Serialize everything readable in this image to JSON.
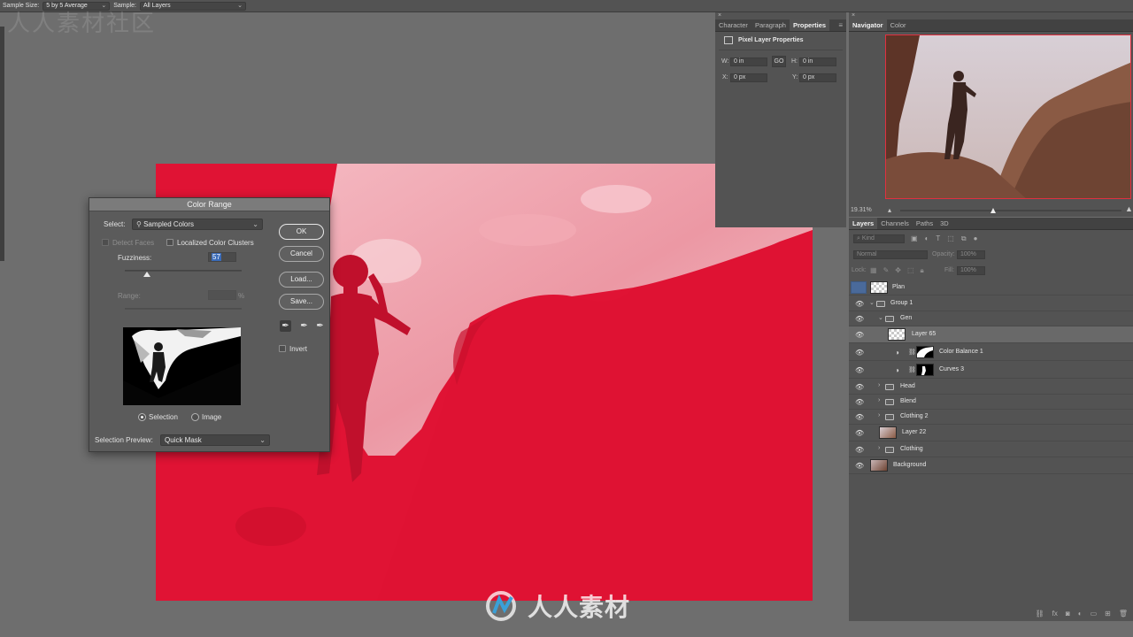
{
  "options_bar": {
    "sample_size_label": "Sample Size:",
    "sample_size_value": "5 by 5 Average",
    "sample_label": "Sample:",
    "sample_value": "All Layers"
  },
  "watermark": {
    "top_text": "人人素材社区",
    "bottom_text": "人人素材"
  },
  "color_range": {
    "title": "Color Range",
    "select_label": "Select:",
    "select_value": "Sampled Colors",
    "detect_faces_label": "Detect Faces",
    "localized_label": "Localized Color Clusters",
    "fuzziness_label": "Fuzziness:",
    "fuzziness_value": "57",
    "range_label": "Range:",
    "range_unit": "%",
    "buttons": {
      "ok": "OK",
      "cancel": "Cancel",
      "load": "Load...",
      "save": "Save..."
    },
    "invert_label": "Invert",
    "radio_selection": "Selection",
    "radio_image": "Image",
    "preview_label": "Selection Preview:",
    "preview_value": "Quick Mask",
    "fuzziness_fraction": 0.19
  },
  "properties_panel": {
    "tabs": [
      "Character",
      "Paragraph",
      "Properties"
    ],
    "title": "Pixel Layer Properties",
    "w_label": "W:",
    "w_value": "0 in",
    "h_label": "H:",
    "h_value": "0 in",
    "x_label": "X:",
    "x_value": "0 px",
    "y_label": "Y:",
    "y_value": "0 px",
    "link_glyph": "GO"
  },
  "navigator_panel": {
    "tabs": [
      "Navigator",
      "Color"
    ],
    "zoom": "19.31%"
  },
  "layers_panel": {
    "tabs": [
      "Layers",
      "Channels",
      "Paths",
      "3D"
    ],
    "kind_placeholder": "Kind",
    "blend_mode": "Normal",
    "opacity_label": "Opacity:",
    "opacity_value": "100%",
    "lock_label": "Lock:",
    "fill_label": "Fill:",
    "fill_value": "100%",
    "layers": [
      {
        "name": "Plan"
      },
      {
        "name": "Group 1"
      },
      {
        "name": "Gen"
      },
      {
        "name": "Layer 65"
      },
      {
        "name": "Color Balance 1"
      },
      {
        "name": "Curves 3"
      },
      {
        "name": "Head"
      },
      {
        "name": "Blend"
      },
      {
        "name": "Clothing 2"
      },
      {
        "name": "Layer 22"
      },
      {
        "name": "Clothing"
      },
      {
        "name": "Background"
      }
    ],
    "footer_icons": [
      "link-icon",
      "fx-icon",
      "mask-icon",
      "adjustment-icon",
      "folder-icon",
      "new-layer-icon",
      "trash-icon"
    ]
  },
  "colors": {
    "quick_mask_red": "#e01334",
    "ui_dark": "#535353",
    "workspace": "#6e6e6e"
  }
}
